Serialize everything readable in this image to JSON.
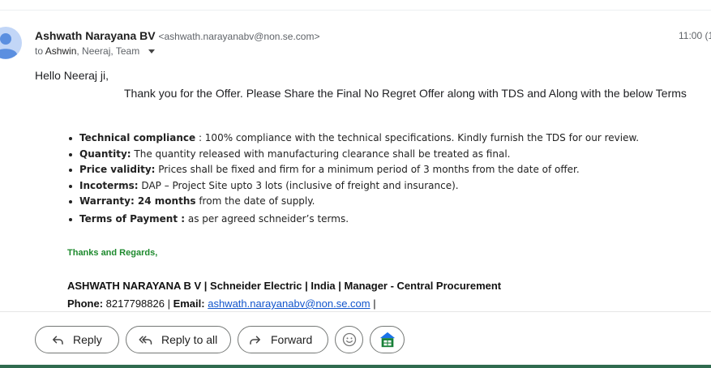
{
  "message": {
    "sender_name": "Ashwath Narayana BV",
    "sender_email": "<ashwath.narayanabv@non.se.com>",
    "to_prefix": "to",
    "to_first": "Ashwin",
    "to_rest": ", Neeraj, Team",
    "time": "11:00 (1"
  },
  "body": {
    "greeting": "Hello Neeraj ji,",
    "intro": "Thank you for the Offer. Please Share the Final No Regret Offer along with TDS and Along with the below Terms",
    "terms": [
      {
        "label": "Technical compliance",
        "text": " : 100% compliance with the technical specifications. Kindly furnish the TDS for our review."
      },
      {
        "label": "Quantity:",
        "text": " The quantity released with manufacturing clearance shall be treated as final."
      },
      {
        "label": "Price validity:",
        "text": " Prices shall be fixed and firm for a minimum period of 3 months from the date of offer."
      },
      {
        "label": "Incoterms:",
        "text": " DAP – Project Site upto 3 lots  (inclusive of freight and insurance)."
      },
      {
        "label": "Warranty: 24 months",
        "text": " from the date of supply."
      },
      {
        "label": "Terms of Payment :",
        "text": " as per agreed schneider’s terms."
      }
    ]
  },
  "signature": {
    "regards": "Thanks and Regards,",
    "line1": "ASHWATH NARAYANA B V |  Schneider Electric | India |  Manager - Central Procurement",
    "phone_label": "Phone:",
    "phone_value": " 8217798826   | ",
    "email_label": "Email:",
    "email_value": "ashwath.narayanabv@non.se.com",
    "trailing": " |"
  },
  "actions": {
    "reply": "Reply",
    "reply_all": "Reply to all",
    "forward": "Forward"
  },
  "icons": {
    "avatar": "person-avatar-icon",
    "caret": "caret-down-icon",
    "reply": "reply-arrow-icon",
    "reply_all": "reply-all-arrow-icon",
    "forward": "forward-arrow-icon",
    "emoji": "emoji-smile-icon",
    "app": "sheets-app-icon"
  },
  "colors": {
    "regards_green": "#1e8a2e",
    "link_blue": "#1155cc",
    "avatar_blue": "#7fa7e8"
  }
}
